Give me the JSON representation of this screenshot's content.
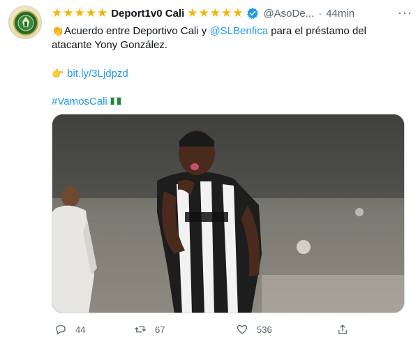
{
  "author": {
    "stars_left": "★★★★★",
    "name": "Deport1v0 Cali",
    "stars_right": "★★★★★",
    "handle": "@AsoDe...",
    "separator": "·",
    "time": "44min",
    "more": "···"
  },
  "body": {
    "line1_prefix": "Acuerdo entre Deportivo Cali y ",
    "mention": "@SLBenfica",
    "line1_suffix": " para el préstamo del",
    "line2": "atacante Yony González.",
    "link": "bit.ly/3Ljdpzd",
    "hashtag": "#VamosCali",
    "emoji_clap": "👏",
    "emoji_point": "👉"
  },
  "actions": {
    "replies": "44",
    "retweets": "67",
    "likes": "536"
  },
  "colors": {
    "link": "#1d9bf0",
    "muted": "#536471",
    "stars": "#f5b400",
    "verified": "#1d9bf0"
  }
}
